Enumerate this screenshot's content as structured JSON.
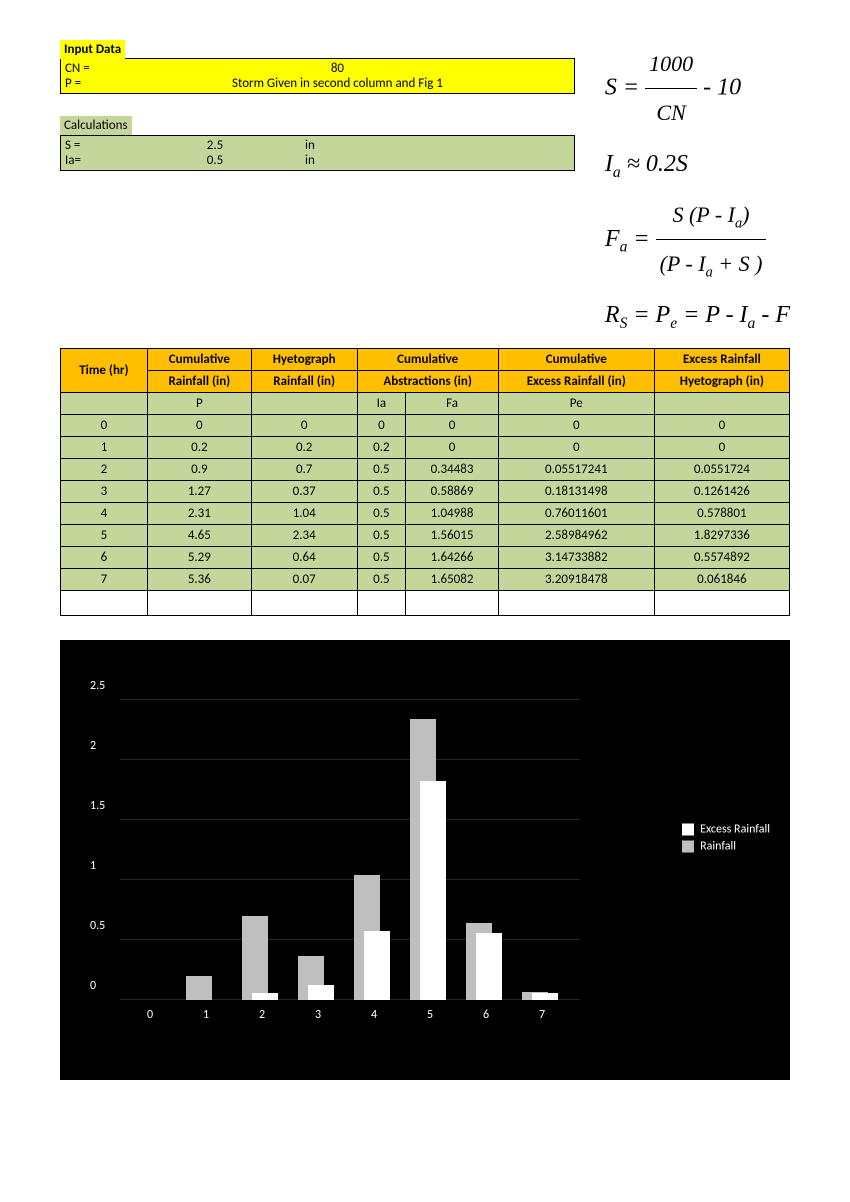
{
  "input": {
    "title": "Input Data",
    "cn_label": "CN =",
    "cn_value": "80",
    "p_label": "P =",
    "p_value": "Storm Given in second column and Fig 1"
  },
  "calc": {
    "title": "Calculations",
    "s_label": "S =",
    "s_value": "2.5",
    "s_unit": "in",
    "ia_label": "Ia=",
    "ia_value": "0.5",
    "ia_unit": "in"
  },
  "eq": {
    "s_minus": "- 10",
    "ia_approx": "≈ 0.2"
  },
  "table": {
    "headers": {
      "time": "Time (hr)",
      "cum_rain1": "Cumulative",
      "cum_rain2": "Rainfall (in)",
      "hyeto1": "Hyetograph",
      "hyeto2": "Rainfall (in)",
      "cum_abs1": "Cumulative",
      "cum_abs2": "Abstractions (in)",
      "cum_ex1": "Cumulative",
      "cum_ex2": "Excess Rainfall (in)",
      "ex_hy1": "Excess Rainfall",
      "ex_hy2": "Hyetograph (in)"
    },
    "vars": {
      "p": "P",
      "ia": "Ia",
      "fa": "Fa",
      "pe": "Pe"
    },
    "rows": [
      {
        "t": "0",
        "P": "0",
        "hy": "0",
        "Ia": "0",
        "Fa": "0",
        "Pe": "0",
        "ex": "0"
      },
      {
        "t": "1",
        "P": "0.2",
        "hy": "0.2",
        "Ia": "0.2",
        "Fa": "0",
        "Pe": "0",
        "ex": "0"
      },
      {
        "t": "2",
        "P": "0.9",
        "hy": "0.7",
        "Ia": "0.5",
        "Fa": "0.34483",
        "Pe": "0.05517241",
        "ex": "0.0551724"
      },
      {
        "t": "3",
        "P": "1.27",
        "hy": "0.37",
        "Ia": "0.5",
        "Fa": "0.58869",
        "Pe": "0.18131498",
        "ex": "0.1261426"
      },
      {
        "t": "4",
        "P": "2.31",
        "hy": "1.04",
        "Ia": "0.5",
        "Fa": "1.04988",
        "Pe": "0.76011601",
        "ex": "0.578801"
      },
      {
        "t": "5",
        "P": "4.65",
        "hy": "2.34",
        "Ia": "0.5",
        "Fa": "1.56015",
        "Pe": "2.58984962",
        "ex": "1.8297336"
      },
      {
        "t": "6",
        "P": "5.29",
        "hy": "0.64",
        "Ia": "0.5",
        "Fa": "1.64266",
        "Pe": "3.14733882",
        "ex": "0.5574892"
      },
      {
        "t": "7",
        "P": "5.36",
        "hy": "0.07",
        "Ia": "0.5",
        "Fa": "1.65082",
        "Pe": "3.20918478",
        "ex": "0.061846"
      }
    ]
  },
  "chart_data": {
    "type": "bar",
    "effect": "3d",
    "categories": [
      "0",
      "1",
      "2",
      "3",
      "4",
      "5",
      "6",
      "7"
    ],
    "series": [
      {
        "name": "Excess Rainfall",
        "color": "#ffffff",
        "values": [
          0,
          0,
          0.0551724,
          0.1261426,
          0.578801,
          1.8297336,
          0.5574892,
          0.061846
        ]
      },
      {
        "name": "Rainfall",
        "color": "#bfbfbf",
        "values": [
          0,
          0.2,
          0.7,
          0.37,
          1.04,
          2.34,
          0.64,
          0.07
        ]
      }
    ],
    "ylim": [
      0,
      2.5
    ],
    "yticks": [
      0,
      0.5,
      1,
      1.5,
      2,
      2.5
    ],
    "title": "",
    "xlabel": "",
    "ylabel": ""
  }
}
